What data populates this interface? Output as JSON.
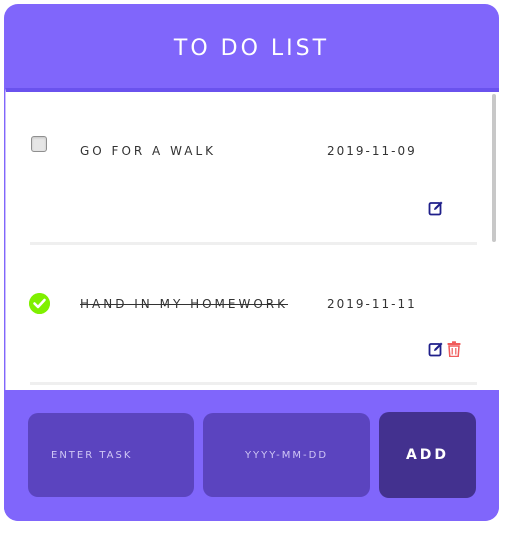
{
  "header": {
    "title": "TO DO LIST"
  },
  "tasks": [
    {
      "text": "GO FOR A WALK",
      "date": "2019-11-09",
      "completed": false
    },
    {
      "text": "HAND IN MY HOMEWORK",
      "date": "2019-11-11",
      "completed": true
    }
  ],
  "input": {
    "task_placeholder": "ENTER TASK",
    "date_placeholder": "YYYY-MM-DD",
    "add_label": "ADD"
  },
  "colors": {
    "accent": "#8066fb",
    "field": "#5b44bf",
    "button": "#43318f",
    "done": "#7ff000",
    "edit": "#1f1f8a",
    "delete": "#f05b5b"
  },
  "icons": [
    "checkbox-empty",
    "check-circle-icon",
    "edit-icon",
    "trash-icon"
  ]
}
